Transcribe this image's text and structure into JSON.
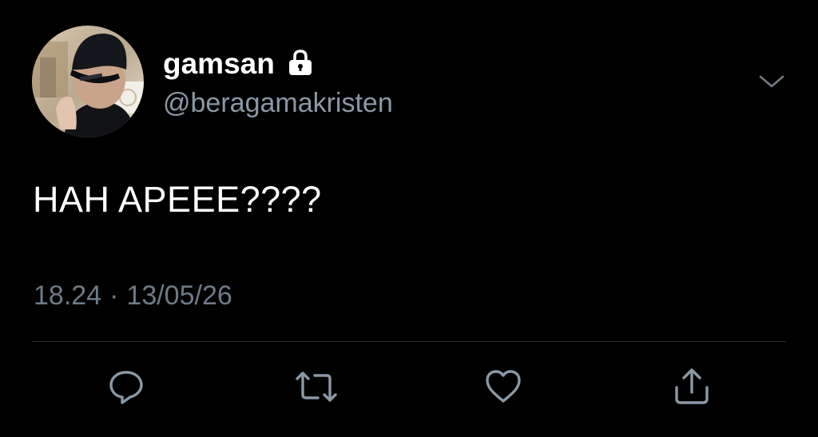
{
  "tweet": {
    "display_name": "gamsan",
    "handle": "@beragamakristen",
    "text": "HAH APEEE????",
    "time": "18.24",
    "separator": "·",
    "date": "13/05/26"
  },
  "icons": {
    "protected": "lock-icon",
    "menu": "chevron-down-icon",
    "reply": "reply-icon",
    "retweet": "retweet-icon",
    "like": "heart-icon",
    "share": "share-icon"
  },
  "colors": {
    "background": "#000000",
    "primary_text": "#ffffff",
    "secondary_text": "#8b98a5",
    "meta_text": "#6e7a86",
    "icon": "#8b98a5",
    "divider": "#2f3336"
  }
}
